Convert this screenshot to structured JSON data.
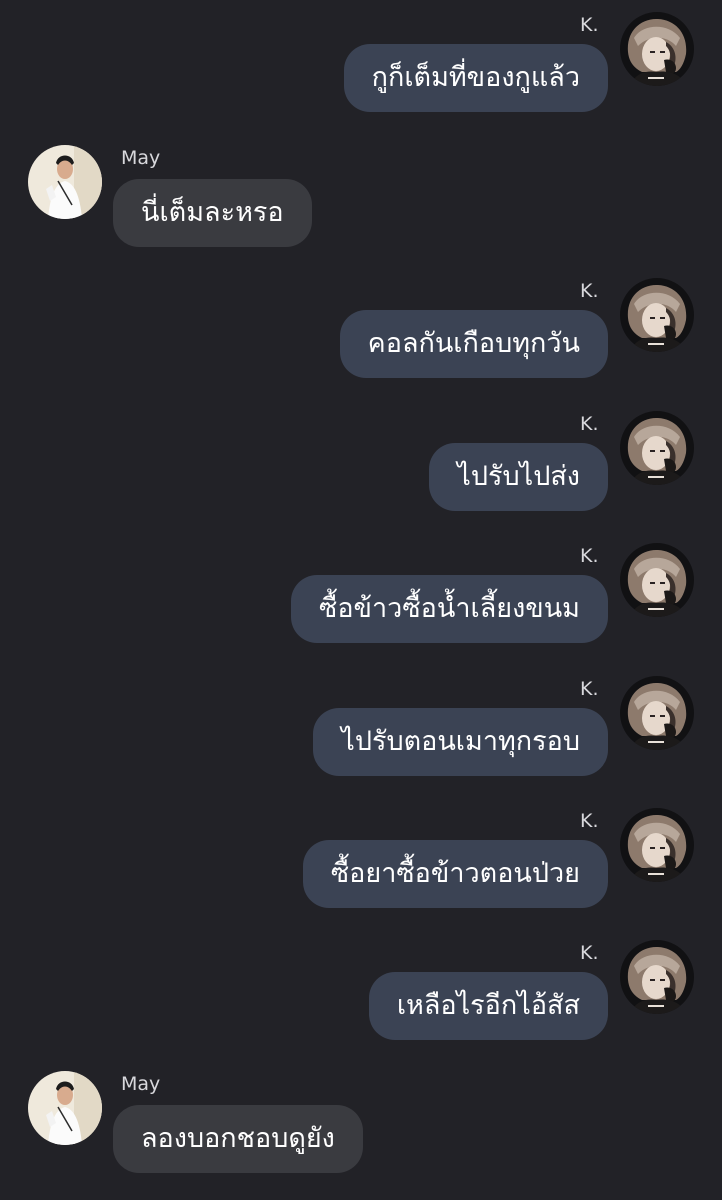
{
  "contacts": {
    "k": {
      "name": "K."
    },
    "may": {
      "name": "May"
    }
  },
  "messages": [
    {
      "sender": "K.",
      "text": "กูก็เต็มที่ของกูแล้ว"
    },
    {
      "sender": "May",
      "text": "นี่เต็มละหรอ"
    },
    {
      "sender": "K.",
      "text": "คอลกันเกือบทุกวัน"
    },
    {
      "sender": "K.",
      "text": "ไปรับไปส่ง"
    },
    {
      "sender": "K.",
      "text": "ซื้อข้าวซื้อน้ำเลี้ยงขนม"
    },
    {
      "sender": "K.",
      "text": "ไปรับตอนเมาทุกรอบ"
    },
    {
      "sender": "K.",
      "text": "ซื้อยาซื้อข้าวตอนป่วย"
    },
    {
      "sender": "K.",
      "text": "เหลือไรอีกไอ้สัส"
    },
    {
      "sender": "May",
      "text": "ลองบอกชอบดูยัง"
    }
  ],
  "colors": {
    "background": "#222227",
    "outgoing_bubble": "#3b4354",
    "incoming_bubble": "#3a3b40",
    "text": "#ffffff"
  }
}
